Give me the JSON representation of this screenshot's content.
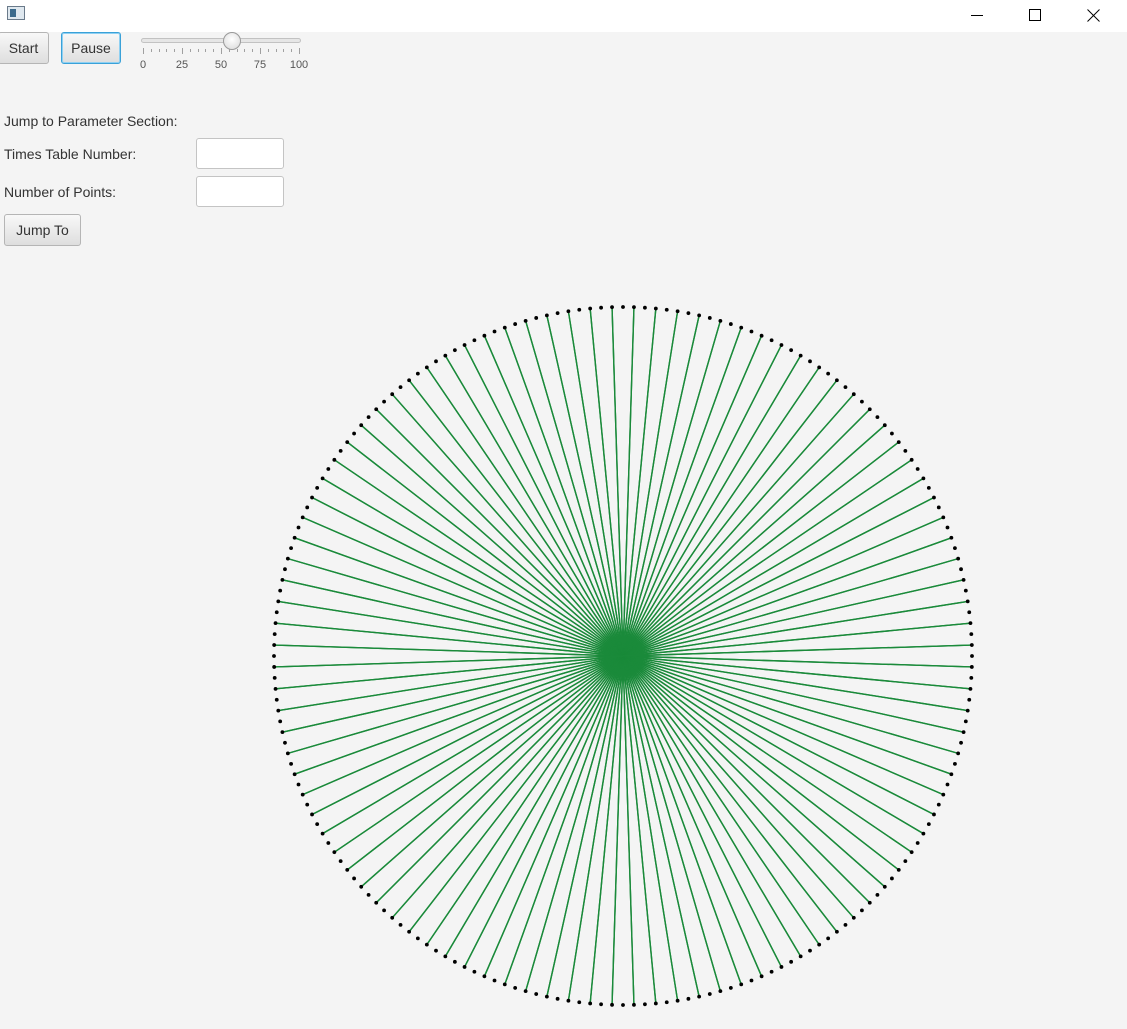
{
  "window": {
    "title": "",
    "controls": {
      "minimize": "minimize-icon",
      "maximize": "maximize-icon",
      "close": "close-icon"
    }
  },
  "toolbar": {
    "start_label": "Start",
    "pause_label": "Pause",
    "speed_slider": {
      "min": 0,
      "max": 100,
      "value": 57,
      "tick_labels": [
        "0",
        "25",
        "50",
        "75",
        "100"
      ]
    }
  },
  "params": {
    "section_label": "Jump to Parameter Section:",
    "times_table_label": "Times Table Number:",
    "times_table_value": "",
    "points_label": "Number of Points:",
    "points_value": "",
    "jump_label": "Jump To"
  },
  "visualization": {
    "points": 200,
    "multiplier": 101,
    "line_color": "#1a8a3a",
    "dot_color": "#000000"
  }
}
